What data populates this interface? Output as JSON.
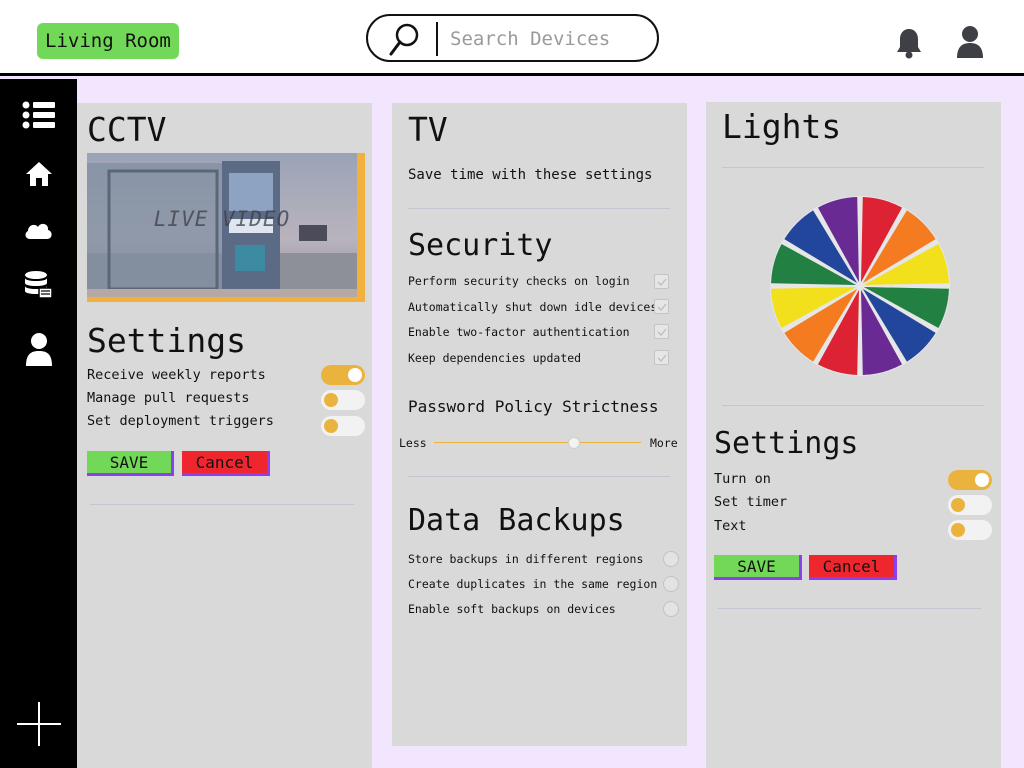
{
  "header": {
    "room": "Living Room",
    "search_placeholder": "Search Devices"
  },
  "sidebar": {
    "icons": [
      "list-icon",
      "home-icon",
      "cloud-icon",
      "database-icon",
      "user-icon"
    ],
    "add_icon": "plus-icon"
  },
  "cctv": {
    "title": "CCTV",
    "video_label": "LIVE VIDEO",
    "settings_title": "Settings",
    "settings": [
      {
        "label": "Receive weekly reports",
        "on": true
      },
      {
        "label": "Manage pull requests",
        "on": false
      },
      {
        "label": "Set deployment triggers",
        "on": false
      }
    ],
    "save": "SAVE",
    "cancel": "Cancel"
  },
  "tv": {
    "title": "TV",
    "subtitle": "Save time with these settings",
    "security_title": "Security",
    "security_items": [
      {
        "label": "Perform security checks on login",
        "checked": true
      },
      {
        "label": "Automatically shut down idle devices",
        "checked": true
      },
      {
        "label": "Enable two-factor authentication",
        "checked": true
      },
      {
        "label": "Keep dependencies updated",
        "checked": true
      }
    ],
    "password_title": "Password Policy Strictness",
    "slider_min": "Less",
    "slider_max": "More",
    "slider_value": 0.68,
    "backups_title": "Data Backups",
    "backup_items": [
      {
        "label": "Store backups in different regions"
      },
      {
        "label": "Create duplicates in the same region"
      },
      {
        "label": "Enable soft backups on devices"
      }
    ]
  },
  "lights": {
    "title": "Lights",
    "wheel_colors": [
      "#dd2233",
      "#f47b20",
      "#f1e01b",
      "#238043",
      "#22469b",
      "#6a2a93",
      "#dd2233",
      "#f47b20",
      "#f1e01b",
      "#238043",
      "#22469b",
      "#6a2a93"
    ],
    "settings_title": "Settings",
    "settings": [
      {
        "label": "Turn on",
        "on": true
      },
      {
        "label": "Set timer",
        "on": false
      },
      {
        "label": "Text",
        "on": false
      }
    ],
    "save": "SAVE",
    "cancel": "Cancel"
  },
  "colors": {
    "accent_green": "#72d958",
    "accent_red": "#f0262f",
    "toggle_yellow": "#eab33e",
    "button_border": "#8a3ff0",
    "background": "#f1e6fd",
    "panel": "#d9d9d9"
  }
}
